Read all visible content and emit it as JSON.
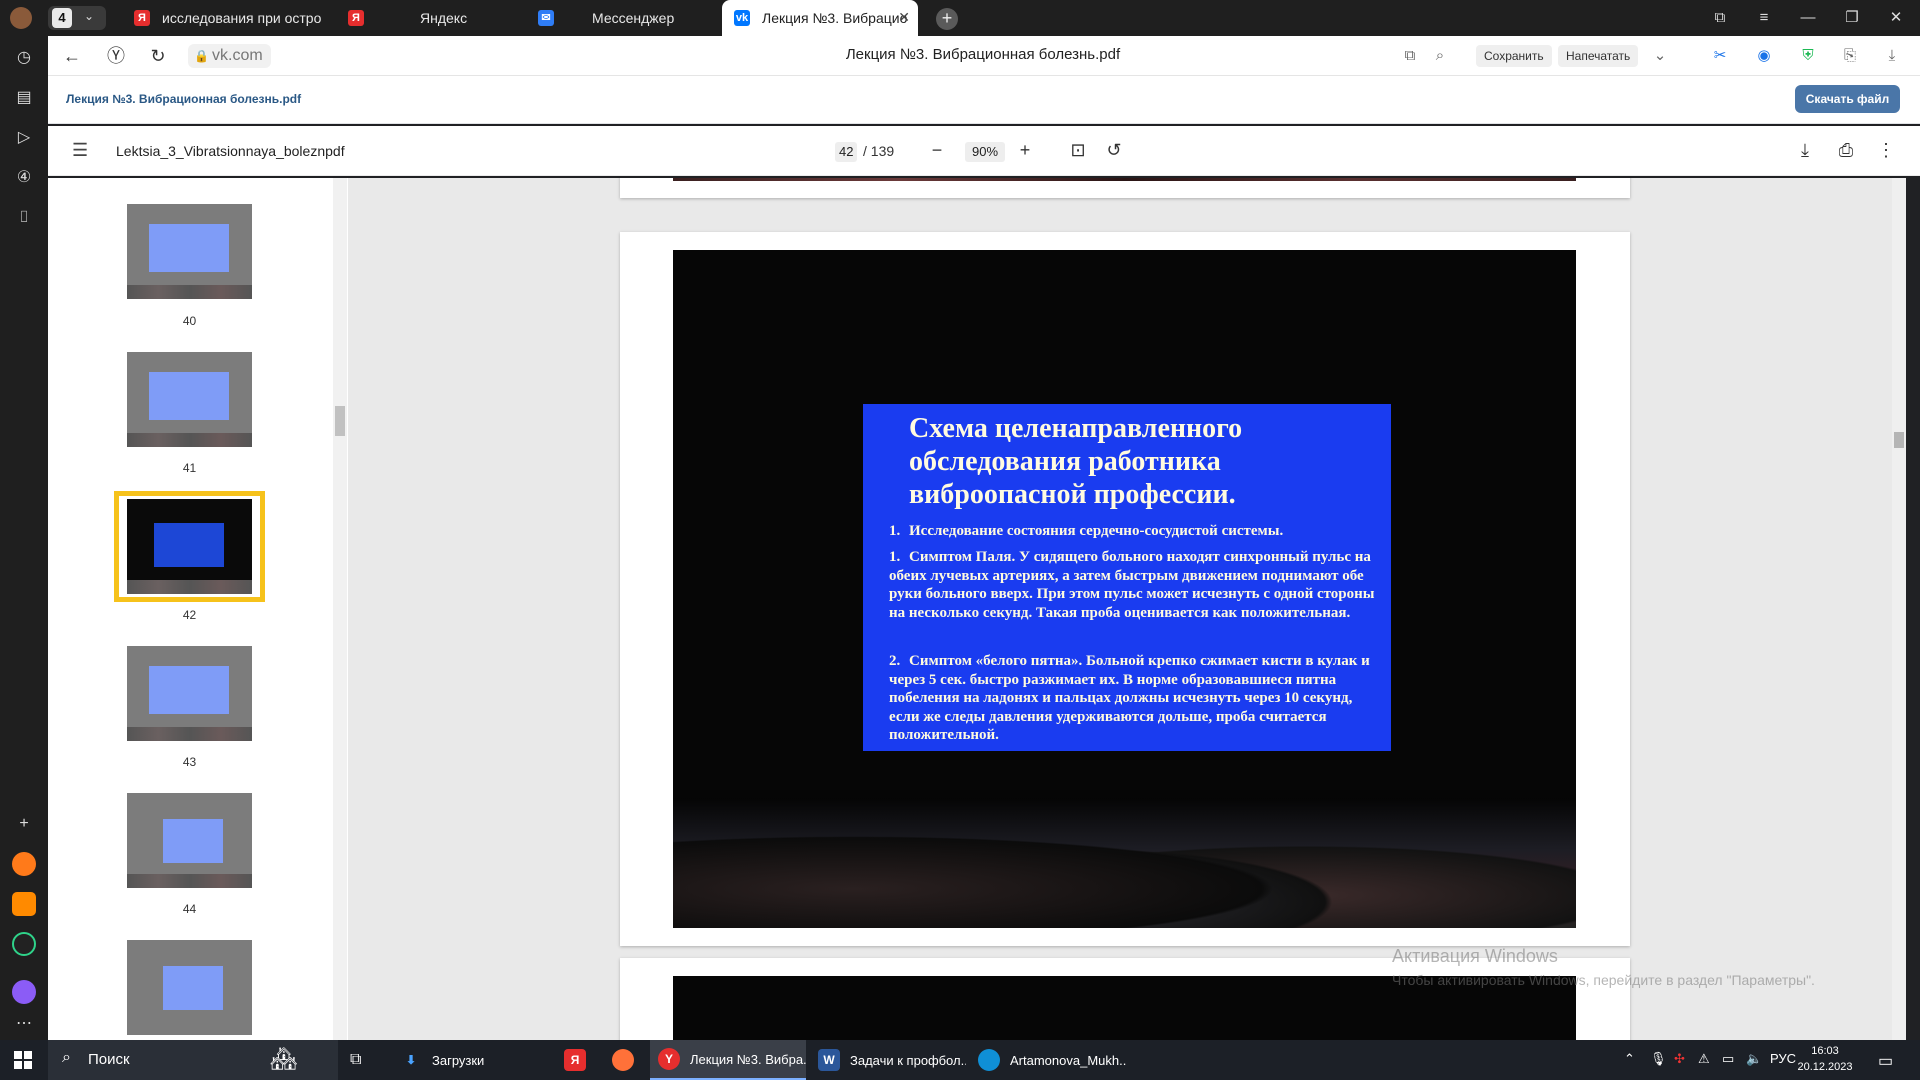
{
  "tabs": {
    "counter": "4",
    "items": [
      {
        "title": "исследования при остро",
        "favicon": "yandex"
      },
      {
        "title": "Яндекс",
        "favicon": "yandex"
      },
      {
        "title": "Мессенджер",
        "favicon": "messenger"
      },
      {
        "title": "Лекция №3. Вибрацио",
        "favicon": "vk",
        "active": true
      }
    ]
  },
  "address": {
    "domain": "vk.com",
    "page_title": "Лекция №3. Вибрационная болезнь.pdf",
    "save_label": "Сохранить",
    "print_label": "Напечатать"
  },
  "vk": {
    "file_title": "Лекция №3. Вибрационная болезнь.pdf",
    "download_label": "Скачать файл"
  },
  "pdf": {
    "filename": "Lektsia_3_Vibratsionnaya_boleznpdf",
    "current_page": "42",
    "total_pages": "/ 139",
    "zoom": "90%"
  },
  "thumbnails": [
    {
      "page": "40"
    },
    {
      "page": "41"
    },
    {
      "page": "42",
      "selected": true
    },
    {
      "page": "43"
    },
    {
      "page": "44"
    }
  ],
  "slide": {
    "title": "Схема целенаправленного обследования работника виброопасной профессии.",
    "item1_num": "1.",
    "item1": "Исследование состояния сердечно-сосудистой системы.",
    "item2_num": "1.",
    "item2": "Симптом  Паля. У сидящего больного находят синхронный пульс на обеих лучевых артериях, а затем быстрым движением поднимают обе руки больного вверх. При этом пульс может исчезнуть с одной стороны на несколько секунд. Такая проба оценивается как положительная.",
    "item3_num": "2.",
    "item3": "Симптом «белого пятна». Больной крепко сжимает кисти в кулак и через 5 сек. быстро разжимает их. В норме образовавшиеся пятна побеления на ладонях и пальцах должны исчезнуть через 10 секунд, если же следы давления удерживаются дольше, проба считается положительной."
  },
  "watermark": {
    "line1": "Активация Windows",
    "line2": "Чтобы активировать Windows, перейдите в раздел \"Параметры\"."
  },
  "taskbar": {
    "search_label": "Поиск",
    "apps": [
      {
        "label": "Загрузки"
      },
      {
        "label": "Лекция №3. Вибра..."
      },
      {
        "label": "Задачи к профбол..."
      },
      {
        "label": "Artamonova_Mukh..."
      }
    ],
    "lang": "РУС",
    "time": "16:03",
    "date": "20.12.2023"
  },
  "colors": {
    "accent": "#4a76a8",
    "selection": "#f6c21b",
    "slide_blue": "#1a3cf0"
  }
}
